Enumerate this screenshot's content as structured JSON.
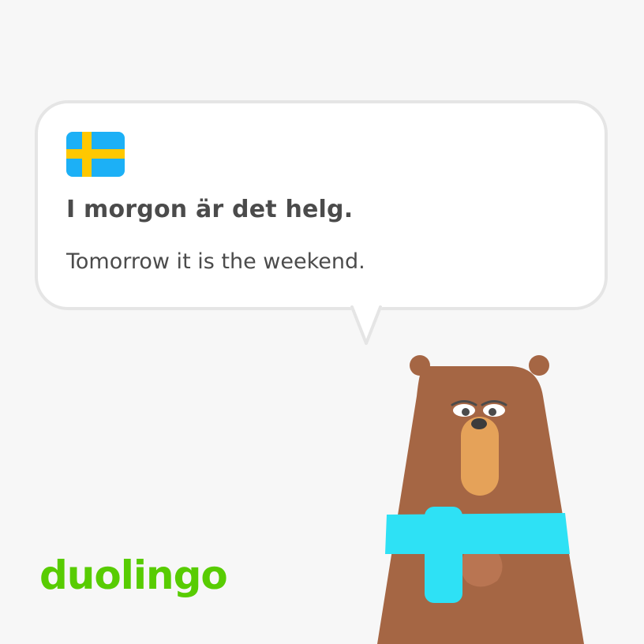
{
  "card": {
    "language_flag_icon": "sweden-flag-icon",
    "sentence": "I morgon är det helg.",
    "translation": "Tomorrow it is the weekend."
  },
  "brand": {
    "logo_text": "duolingo",
    "logo_color": "#58cc02"
  },
  "mascot": {
    "icon": "bear-character-icon"
  },
  "colors": {
    "background": "#f7f7f7",
    "bubble_border": "#e5e5e5",
    "text": "#4b4b4b",
    "flag_blue": "#1cb0f6",
    "flag_yellow": "#ffc800",
    "bear_brown": "#a56644",
    "bear_muzzle": "#e5a259",
    "scarf": "#2ee1f5"
  }
}
